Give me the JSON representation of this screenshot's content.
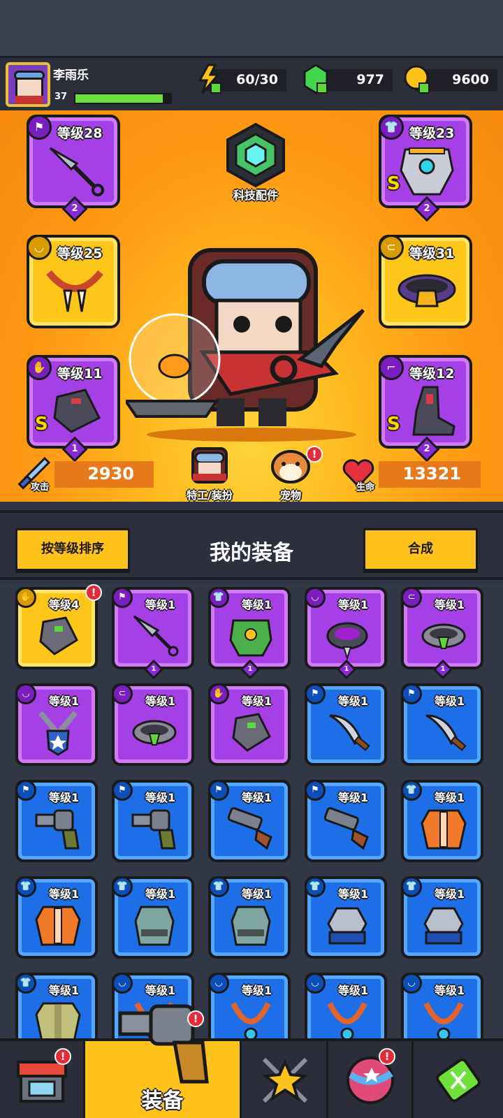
{
  "player": {
    "name": "李雨乐",
    "level": "37",
    "xp_progress": 0.92
  },
  "resources": {
    "energy": "60/30",
    "gems": "977",
    "coins": "9600"
  },
  "tech_parts": {
    "label": "科技配件"
  },
  "equipped": [
    {
      "slot": "weapon",
      "level": "等级28",
      "stars": "2",
      "rarity": "purple",
      "icon": "kunai-icon"
    },
    {
      "slot": "armor",
      "level": "等级23",
      "stars": "2",
      "rarity": "purple",
      "rank": "S",
      "icon": "mech-armor-icon"
    },
    {
      "slot": "necklace",
      "level": "等级25",
      "rarity": "yellow",
      "icon": "fang-necklace-icon"
    },
    {
      "slot": "belt",
      "level": "等级31",
      "rarity": "yellow",
      "icon": "belt-icon"
    },
    {
      "slot": "gloves",
      "level": "等级11",
      "stars": "1",
      "rarity": "purple",
      "rank": "S",
      "icon": "gauntlet-icon"
    },
    {
      "slot": "boots",
      "level": "等级12",
      "stars": "2",
      "rarity": "purple",
      "rank": "S",
      "icon": "boots-icon"
    }
  ],
  "stats": {
    "attack_label": "攻击",
    "attack": "2930",
    "hp_label": "生命",
    "hp": "13321"
  },
  "agent_label": "特工/装扮",
  "pet_label": "宠物",
  "alert_mark": "!",
  "toolbar": {
    "sort_label": "按等级排序",
    "title": "我的装备",
    "merge_label": "合成"
  },
  "inventory": [
    {
      "level": "等级4",
      "rarity": "yellow",
      "cat": "glove",
      "icon": "gauntlet-icon",
      "new": true
    },
    {
      "level": "等级1",
      "rarity": "purple",
      "cat": "weapon",
      "icon": "kunai-icon",
      "stars": "1"
    },
    {
      "level": "等级1",
      "rarity": "purple",
      "cat": "armor",
      "icon": "leaf-armor-icon",
      "stars": "1"
    },
    {
      "level": "等级1",
      "rarity": "purple",
      "cat": "necklace",
      "icon": "spike-collar-icon",
      "stars": "1"
    },
    {
      "level": "等级1",
      "rarity": "purple",
      "cat": "belt",
      "icon": "belt-icon",
      "stars": "1"
    },
    {
      "level": "等级1",
      "rarity": "purple",
      "cat": "necklace",
      "icon": "badge-necklace-icon"
    },
    {
      "level": "等级1",
      "rarity": "purple",
      "cat": "belt",
      "icon": "belt-icon"
    },
    {
      "level": "等级1",
      "rarity": "purple",
      "cat": "glove",
      "icon": "gauntlet-icon"
    },
    {
      "level": "等级1",
      "rarity": "blue",
      "cat": "weapon",
      "icon": "machete-icon"
    },
    {
      "level": "等级1",
      "rarity": "blue",
      "cat": "weapon",
      "icon": "machete-icon"
    },
    {
      "level": "等级1",
      "rarity": "blue",
      "cat": "weapon",
      "icon": "revolver-icon"
    },
    {
      "level": "等级1",
      "rarity": "blue",
      "cat": "weapon",
      "icon": "revolver-icon"
    },
    {
      "level": "等级1",
      "rarity": "blue",
      "cat": "weapon",
      "icon": "shotgun-icon"
    },
    {
      "level": "等级1",
      "rarity": "blue",
      "cat": "weapon",
      "icon": "shotgun-icon"
    },
    {
      "level": "等级1",
      "rarity": "blue",
      "cat": "armor",
      "icon": "jacket-icon"
    },
    {
      "level": "等级1",
      "rarity": "blue",
      "cat": "armor",
      "icon": "jacket-icon"
    },
    {
      "level": "等级1",
      "rarity": "blue",
      "cat": "armor",
      "icon": "vest-icon"
    },
    {
      "level": "等级1",
      "rarity": "blue",
      "cat": "armor",
      "icon": "vest-icon"
    },
    {
      "level": "等级1",
      "rarity": "blue",
      "cat": "armor",
      "icon": "shoulder-armor-icon"
    },
    {
      "level": "等级1",
      "rarity": "blue",
      "cat": "armor",
      "icon": "shoulder-armor-icon"
    },
    {
      "level": "等级1",
      "rarity": "blue",
      "cat": "armor",
      "icon": "shirt-icon"
    },
    {
      "level": "等级1",
      "rarity": "blue",
      "cat": "necklace",
      "icon": "necklace-icon"
    },
    {
      "level": "等级1",
      "rarity": "blue",
      "cat": "necklace",
      "icon": "necklace-icon"
    },
    {
      "level": "等级1",
      "rarity": "blue",
      "cat": "necklace",
      "icon": "necklace-icon"
    },
    {
      "level": "等级1",
      "rarity": "blue",
      "cat": "necklace",
      "icon": "necklace-icon"
    }
  ],
  "nav": {
    "shop_icon": "shop-icon",
    "equip_label": "装备",
    "star_icon": "star-swords-icon",
    "planet_icon": "planet-icon",
    "battery_icon": "dna-battery-icon"
  },
  "colors": {
    "purple": "#a53fe6",
    "yellow": "#ffc61a",
    "blue": "#1e6ee8",
    "accent": "#ffc21a"
  }
}
